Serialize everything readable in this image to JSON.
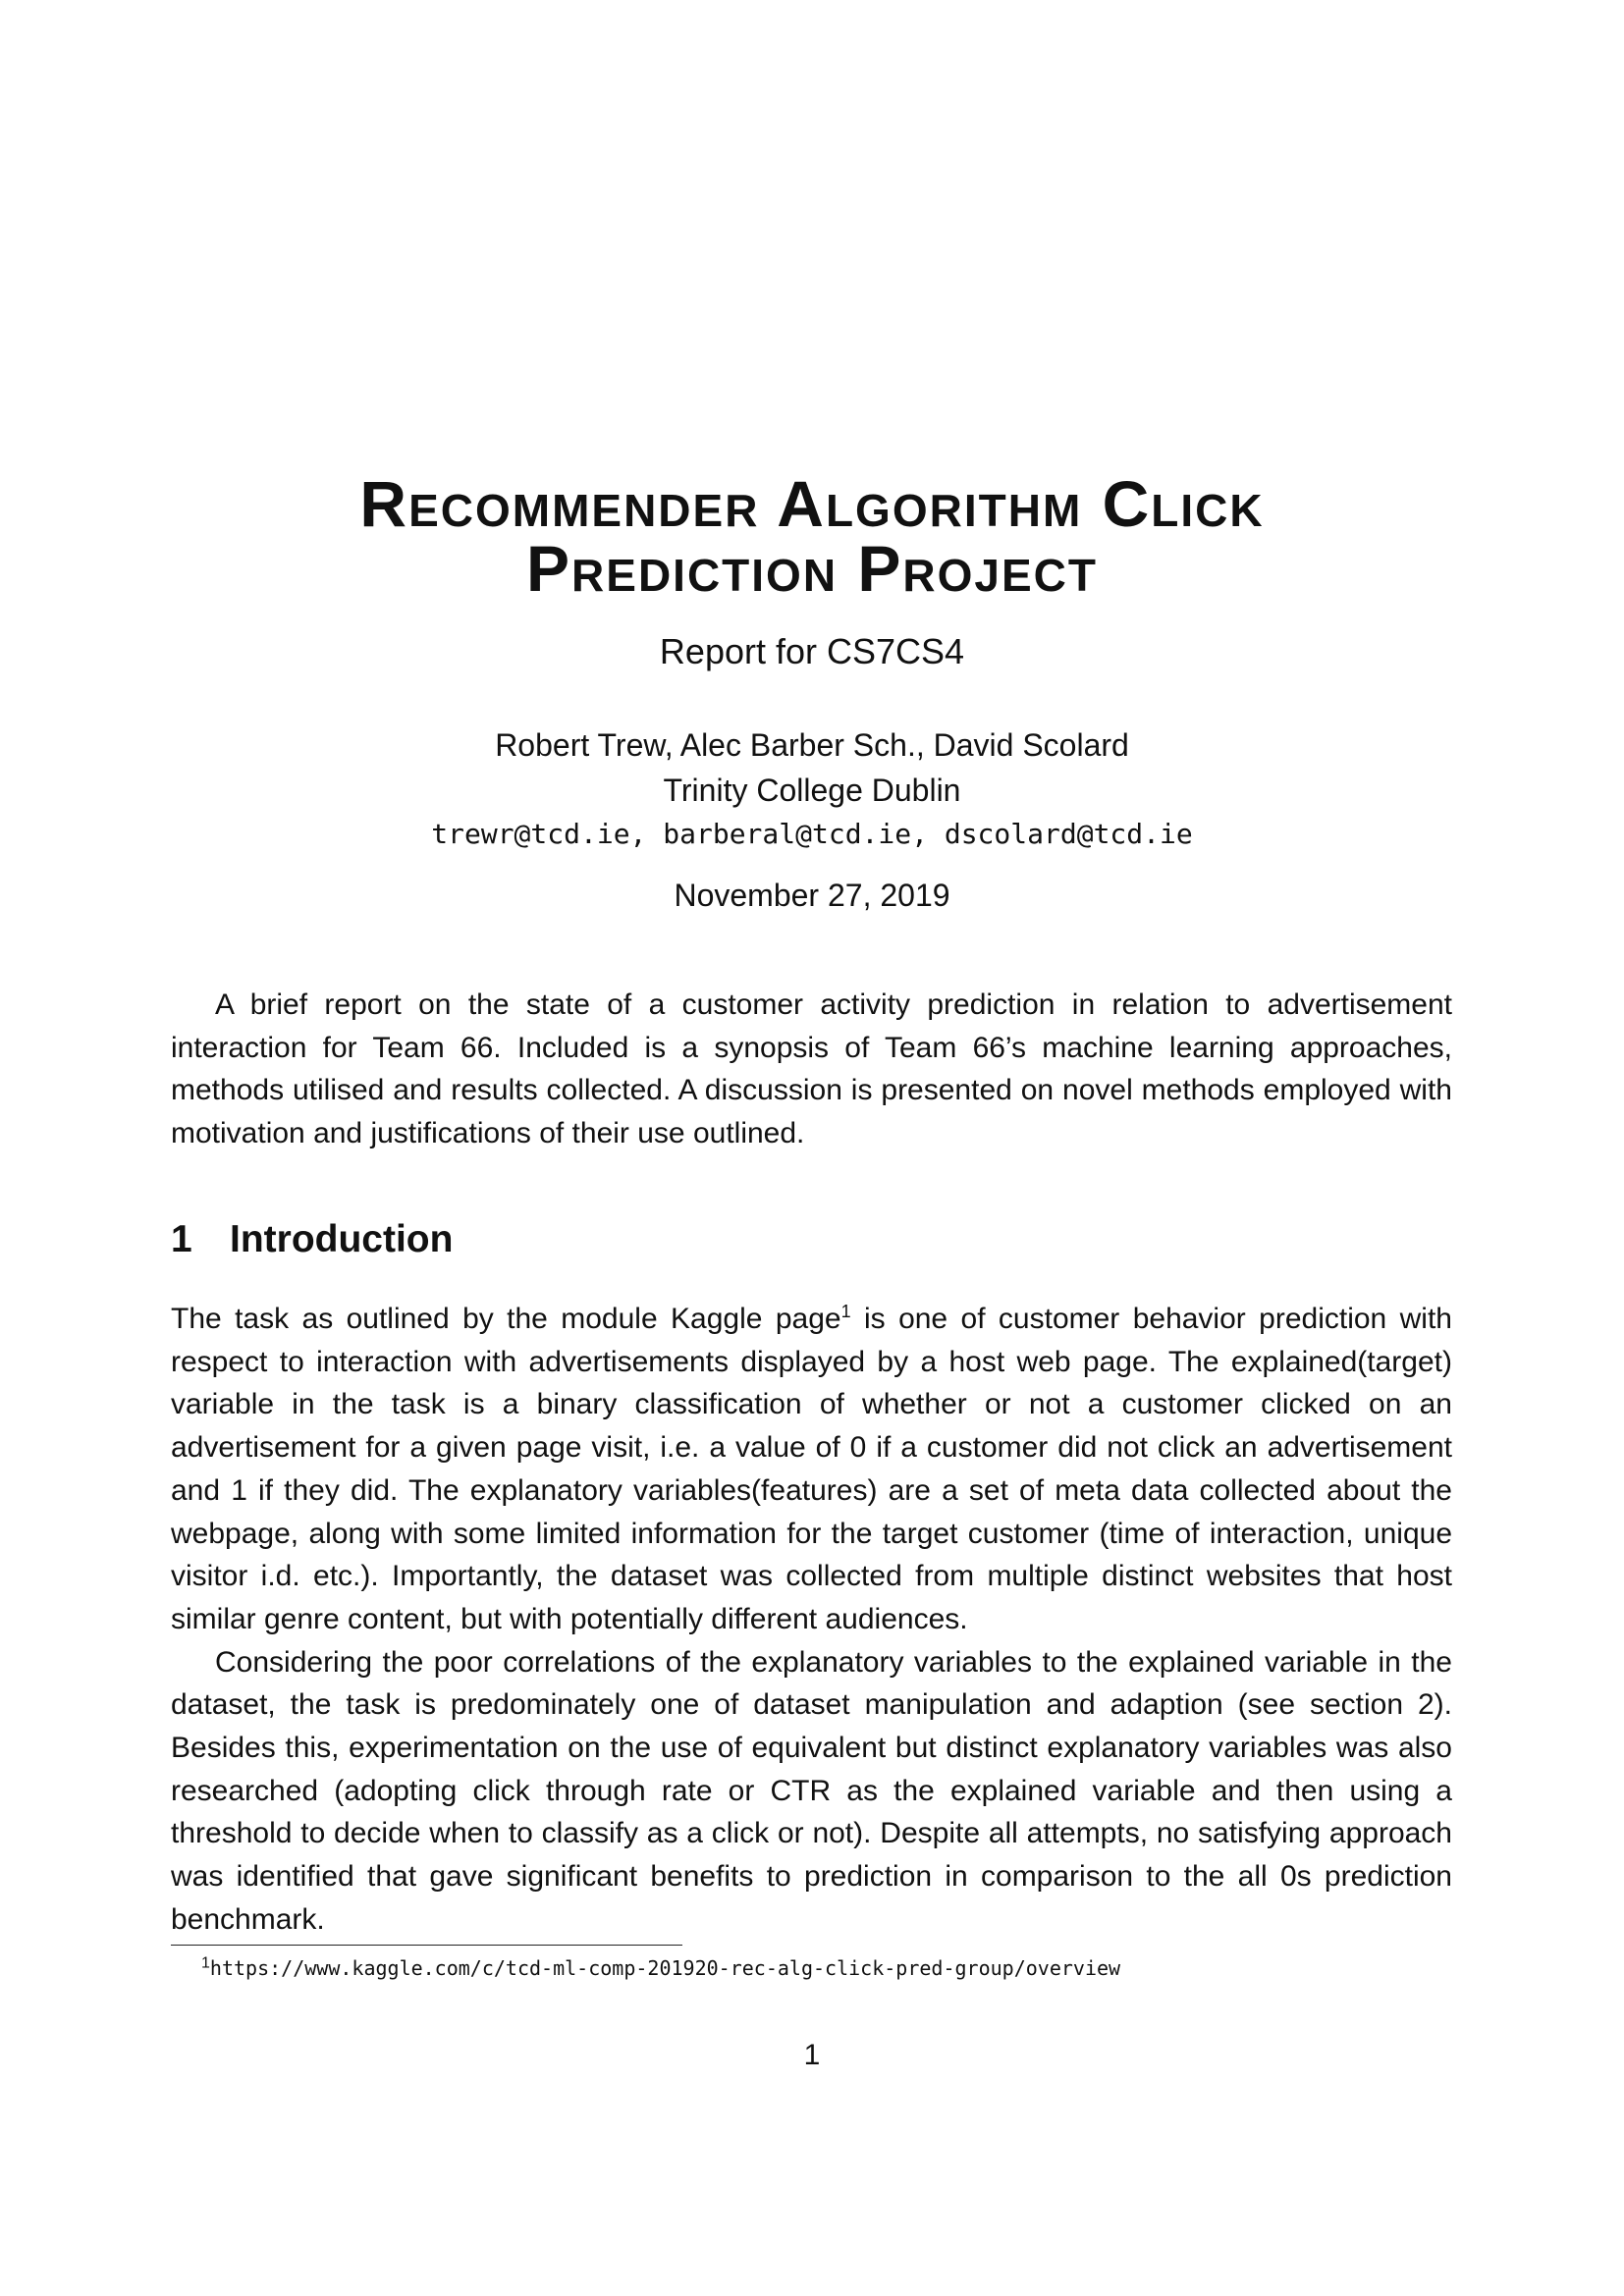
{
  "title": {
    "line1": "Recommender Algorithm Click",
    "line2": "Prediction Project"
  },
  "subtitle": "Report for CS7CS4",
  "authors": "Robert Trew, Alec Barber Sch., David Scolard",
  "affiliation": "Trinity College Dublin",
  "emails": "trewr@tcd.ie, barberal@tcd.ie, dscolard@tcd.ie",
  "date": "November 27, 2019",
  "abstract": "A brief report on the state of a customer activity prediction in relation to advertisement interaction for Team 66. Included is a synopsis of Team 66’s machine learning approaches, methods utilised and results collected. A discussion is presented on novel methods employed with motivation and justifications of their use outlined.",
  "section1": {
    "number": "1",
    "title": "Introduction",
    "p1_before_ref": "The task as outlined by the module Kaggle page",
    "p1_ref": "1",
    "p1_after_ref": " is one of customer behavior prediction with respect to interaction with advertisements displayed by a host web page. The explained(target) variable in the task is a binary classification of whether or not a customer clicked on an advertisement for a given page visit, i.e. a value of 0 if a customer did not click an advertisement and 1 if they did. The explanatory variables(features) are a set of meta data collected about the webpage, along with some limited information for the target customer (time of interaction, unique visitor i.d. etc.). Importantly, the dataset was collected from multiple distinct websites that host similar genre content, but with potentially different audiences.",
    "p2": "Considering the poor correlations of the explanatory variables to the explained variable in the dataset, the task is predominately one of dataset manipulation and adaption (see section 2). Besides this, experimentation on the use of equivalent but distinct explanatory variables was also researched (adopting click through rate or CTR as the explained variable and then using a threshold to decide when to classify as a click or not). Despite all attempts, no satisfying approach was identified that gave significant benefits to prediction in comparison to the all 0s prediction benchmark."
  },
  "footnote": {
    "mark": "1",
    "text": "https://www.kaggle.com/c/tcd-ml-comp-201920-rec-alg-click-pred-group/overview"
  },
  "page_number": "1"
}
